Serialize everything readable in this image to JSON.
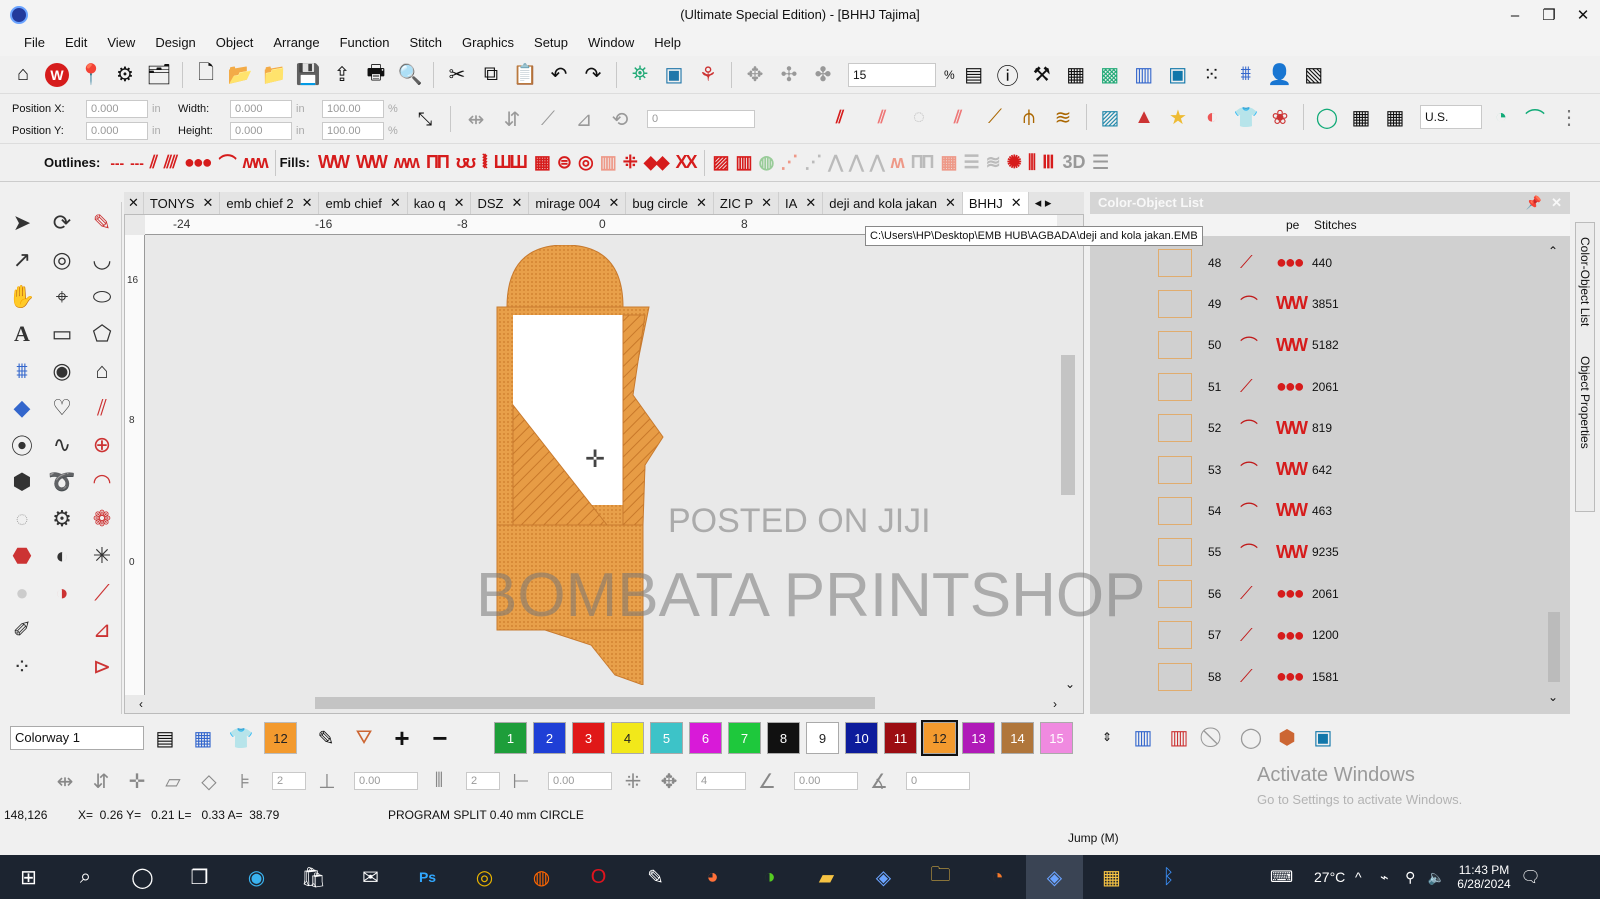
{
  "window": {
    "title": "(Ultimate Special Edition) - [BHHJ        Tajima]",
    "controls": [
      "–",
      "❐",
      "✕"
    ]
  },
  "menu": [
    "File",
    "Edit",
    "View",
    "Design",
    "Object",
    "Arrange",
    "Function",
    "Stitch",
    "Graphics",
    "Setup",
    "Window",
    "Help"
  ],
  "toolbar": {
    "zoom_value": "15",
    "zoom_unit": "%"
  },
  "position": {
    "x_label": "Position X:",
    "x_value": "0.000",
    "y_label": "Position Y:",
    "y_value": "0.000",
    "w_label": "Width:",
    "w_value": "0.000",
    "h_label": "Height:",
    "h_value": "0.000",
    "pct_w": "100.00",
    "pct_h": "100.00",
    "unit": "in",
    "rotate_value": "0",
    "units_select": "U.S."
  },
  "rows": {
    "outlines_label": "Outlines:",
    "fills_label": "Fills:",
    "threed_label": "3D"
  },
  "tabs": [
    "TONYS",
    "emb chief 2",
    "emb chief",
    "kao q",
    "DSZ",
    "mirage 004",
    "bug circle",
    "ZIC P",
    "IA",
    "deji and kola jakan",
    "BHHJ"
  ],
  "active_tab": "BHHJ",
  "ruler": {
    "h_labels": [
      "-24",
      "-16",
      "-8",
      "0",
      "8"
    ],
    "v_labels": [
      "16",
      "8",
      "0"
    ]
  },
  "tooltip": "C:\\Users\\HP\\Desktop\\EMB HUB\\AGBADA\\deji and kola jakan.EMB",
  "panel": {
    "title": "Color-Object List",
    "col_type": "pe",
    "col_stitches": "Stitches",
    "objects": [
      {
        "num": "48",
        "stitches": "440",
        "kind": "run"
      },
      {
        "num": "49",
        "stitches": "3851",
        "kind": "fill"
      },
      {
        "num": "50",
        "stitches": "5182",
        "kind": "fill"
      },
      {
        "num": "51",
        "stitches": "2061",
        "kind": "run"
      },
      {
        "num": "52",
        "stitches": "819",
        "kind": "fill"
      },
      {
        "num": "53",
        "stitches": "642",
        "kind": "fill"
      },
      {
        "num": "54",
        "stitches": "463",
        "kind": "fill"
      },
      {
        "num": "55",
        "stitches": "9235",
        "kind": "fill"
      },
      {
        "num": "56",
        "stitches": "2061",
        "kind": "run"
      },
      {
        "num": "57",
        "stitches": "1200",
        "kind": "run"
      },
      {
        "num": "58",
        "stitches": "1581",
        "kind": "run"
      }
    ],
    "side_tabs": [
      "Color-Object List",
      "Object Properties"
    ]
  },
  "colorbar": {
    "colorway": "Colorway 1",
    "current": "12",
    "swatches": [
      {
        "label": "1",
        "color": "#1e9e3a"
      },
      {
        "label": "2",
        "color": "#1f3fd6"
      },
      {
        "label": "3",
        "color": "#e01818"
      },
      {
        "label": "4",
        "color": "#f2e81a"
      },
      {
        "label": "5",
        "color": "#3dc3c8"
      },
      {
        "label": "6",
        "color": "#d81ad8"
      },
      {
        "label": "7",
        "color": "#1ec83c"
      },
      {
        "label": "8",
        "color": "#111111"
      },
      {
        "label": "9",
        "color": "#ffffff"
      },
      {
        "label": "10",
        "color": "#0d1c9c"
      },
      {
        "label": "11",
        "color": "#9c0d12"
      },
      {
        "label": "12",
        "color": "#f39a2e"
      },
      {
        "label": "13",
        "color": "#b01ab8"
      },
      {
        "label": "14",
        "color": "#b0763b"
      },
      {
        "label": "15",
        "color": "#f08ae0"
      }
    ]
  },
  "bottombar": {
    "v1": "2",
    "v2": "0.00",
    "v3": "2",
    "v4": "0.00",
    "v5": "4",
    "v6": "0.00",
    "v7": "0"
  },
  "status": {
    "coords": "148,126",
    "measure": "X=  0.26 Y=   0.21 L=   0.33 A=  38.79",
    "program": "PROGRAM SPLIT 0.40 mm CIRCLE",
    "jump": "Jump (M)"
  },
  "activation": {
    "title": "Activate Windows",
    "sub": "Go to Settings to activate Windows."
  },
  "watermark": {
    "small": "POSTED ON JIJI",
    "big": "BOMBATA PRINTSHOP"
  },
  "taskbar": {
    "temp": "27°C",
    "time": "11:43 PM",
    "date": "6/28/2024",
    "apps": [
      "windows-start",
      "search",
      "cortana",
      "task-view",
      "edge",
      "store",
      "mail",
      "photoshop",
      "chrome",
      "app-orange",
      "opera",
      "app-pen",
      "firefox",
      "app-green",
      "app-folder-yellow",
      "app-emb",
      "file-explorer",
      "app-blender",
      "app-emb-active",
      "app-photos",
      "bluetooth"
    ]
  },
  "colors": {
    "embroidery": "#e79c45",
    "accent_red": "#d61c1c"
  }
}
